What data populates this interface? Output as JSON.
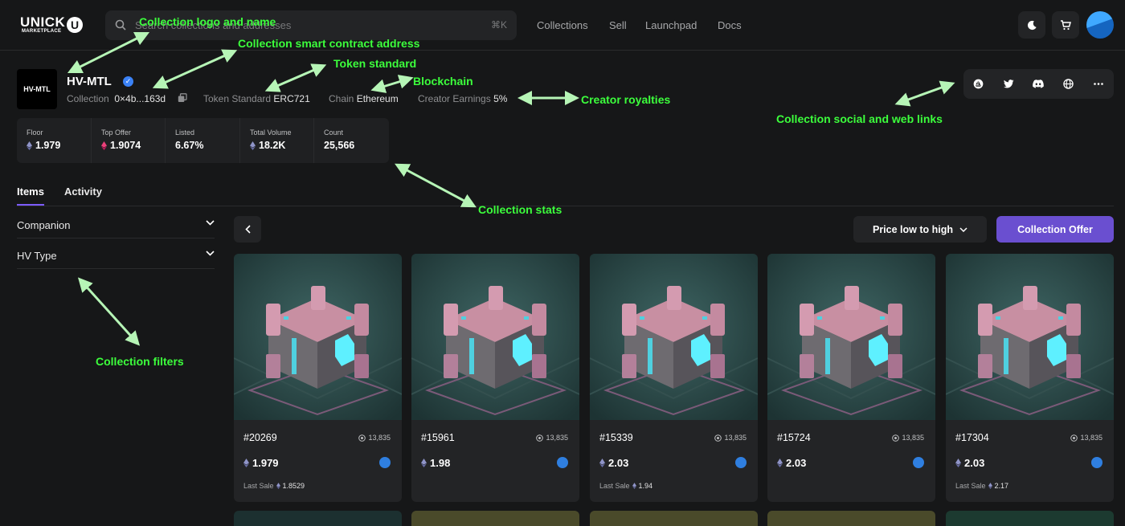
{
  "header": {
    "logo_line1": "UNICK",
    "logo_u": "U",
    "logo_line2": "MARKETPLACE",
    "search_placeholder": "Search collections and addresses",
    "search_shortcut": "⌘K",
    "nav": [
      "Collections",
      "Sell",
      "Launchpad",
      "Docs"
    ],
    "icons": [
      "moon-icon",
      "cart-icon",
      "avatar"
    ]
  },
  "collection": {
    "logo_text": "HV-MTL",
    "name": "HV-MTL",
    "collection_label": "Collection",
    "address": "0×4b...163d",
    "token_standard_label": "Token Standard",
    "token_standard": "ERC721",
    "chain_label": "Chain",
    "chain": "Ethereum",
    "creator_earnings_label": "Creator Earnings",
    "creator_earnings": "5%",
    "social_icons": [
      "opensea-icon",
      "twitter-icon",
      "discord-icon",
      "globe-icon",
      "more-icon"
    ]
  },
  "stats": [
    {
      "label": "Floor",
      "value": "1.979",
      "icon": "eth"
    },
    {
      "label": "Top Offer",
      "value": "1.9074",
      "icon": "weth"
    },
    {
      "label": "Listed",
      "value": "6.67%"
    },
    {
      "label": "Total Volume",
      "value": "18.2K",
      "icon": "eth"
    },
    {
      "label": "Count",
      "value": "25,566"
    }
  ],
  "tabs": [
    "Items",
    "Activity"
  ],
  "filters": [
    "Companion",
    "HV Type"
  ],
  "toolbar": {
    "sort_label": "Price low to high",
    "offer_label": "Collection Offer"
  },
  "items": [
    {
      "id": "#20269",
      "rank": "13,835",
      "price": "1.979",
      "last_sale_label": "Last Sale",
      "last_sale": "1.8529"
    },
    {
      "id": "#15961",
      "rank": "13,835",
      "price": "1.98"
    },
    {
      "id": "#15339",
      "rank": "13,835",
      "price": "2.03",
      "last_sale_label": "Last Sale",
      "last_sale": "1.94"
    },
    {
      "id": "#15724",
      "rank": "13,835",
      "price": "2.03"
    },
    {
      "id": "#17304",
      "rank": "13,835",
      "price": "2.03",
      "last_sale_label": "Last Sale",
      "last_sale": "2.17"
    }
  ],
  "annotations": {
    "logo": "Collection logo and name",
    "contract": "Collection smart contract address",
    "token": "Token standard",
    "chain": "Blockchain",
    "royalties": "Creator royalties",
    "social": "Collection social and web links",
    "stats": "Collection stats",
    "filters": "Collection filters"
  },
  "colors": {
    "accent": "#6a4fd0",
    "annotation": "#3cff3c",
    "background": "#161718"
  }
}
